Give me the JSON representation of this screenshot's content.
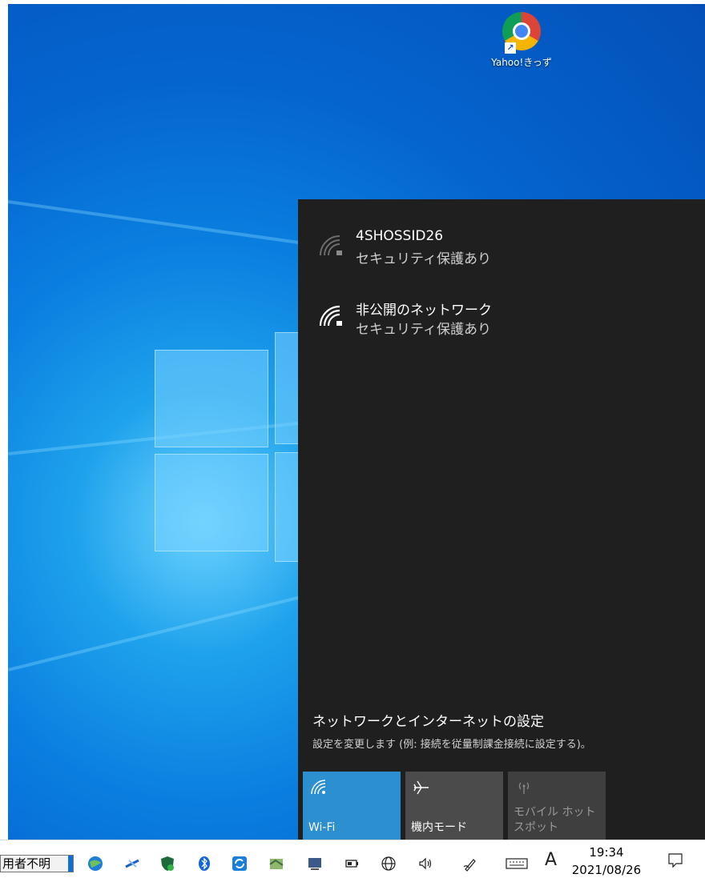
{
  "desktop": {
    "shortcut": {
      "label": "Yahoo!きっず",
      "arrow": "↗"
    }
  },
  "flyout": {
    "networks": [
      {
        "name": "4SHOSSID26",
        "status": "セキュリティ保護あり",
        "icon": "wifi-secured-icon",
        "strength": "weak"
      },
      {
        "name": "非公開のネットワーク",
        "status": "セキュリティ保護あり",
        "icon": "wifi-secured-icon",
        "strength": "strong"
      }
    ],
    "settings": {
      "title": "ネットワークとインターネットの設定",
      "subtitle": "設定を変更します (例: 接続を従量制課金接続に設定する)。"
    },
    "tiles": [
      {
        "label": "Wi-Fi",
        "icon": "wifi-icon",
        "state": "on"
      },
      {
        "label": "機内モード",
        "icon": "airplane-icon",
        "state": "off"
      },
      {
        "label": "モバイル ホットスポット",
        "icon": "hotspot-icon",
        "state": "disabled"
      }
    ]
  },
  "taskbar": {
    "user": "用者不明",
    "ime": "A",
    "clock": {
      "time": "19:34",
      "date": "2021/08/26"
    }
  },
  "colors": {
    "flyout_bg": "#1f1f1f",
    "accent": "#2b8fd0",
    "tile_off": "#4b4b4b"
  }
}
